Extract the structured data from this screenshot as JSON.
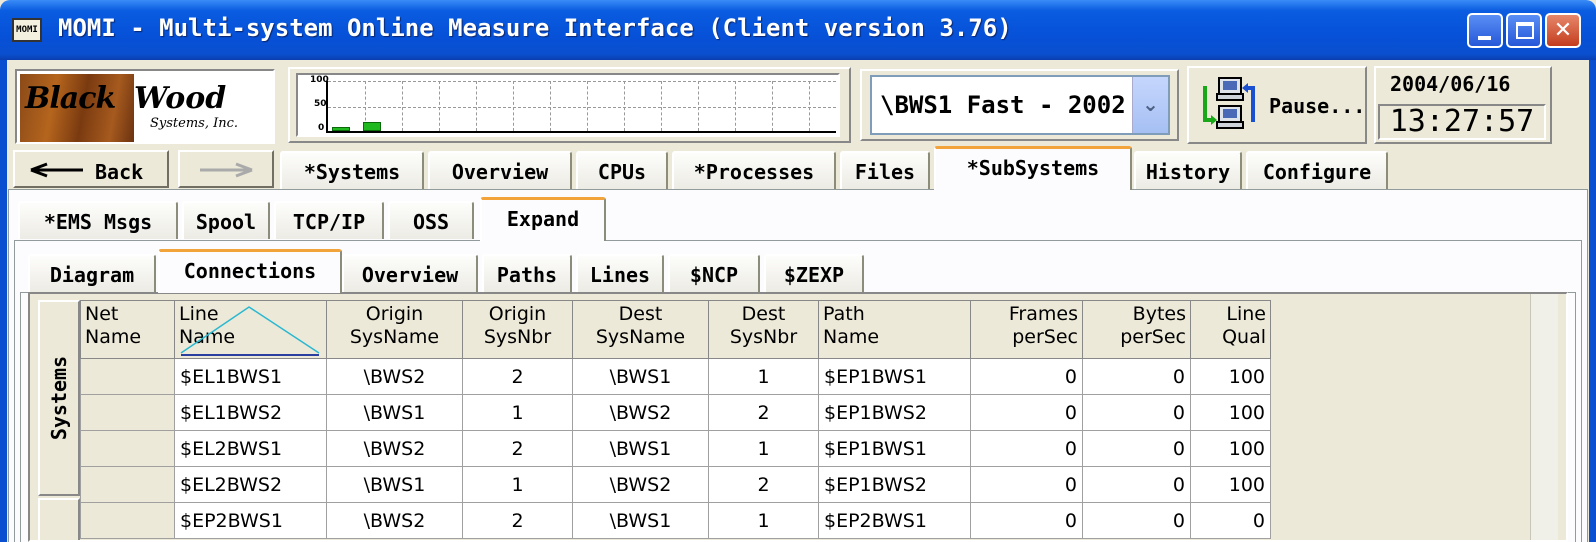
{
  "window": {
    "title": "MOMI - Multi-system Online Measure Interface (Client version 3.76)",
    "icon_text": "MOMI"
  },
  "logo": {
    "word1": "Black",
    "word2": "Wood",
    "sub": "Systems, Inc."
  },
  "graph": {
    "y_labels": [
      "100",
      "50",
      "0"
    ],
    "values": [
      8,
      18
    ]
  },
  "system_select": {
    "value": "\\BWS1 Fast - 2002"
  },
  "pause": {
    "label": "Pause..."
  },
  "datetime": {
    "date": "2004/06/16",
    "time": "13:27:57"
  },
  "nav": {
    "back_label": "Back"
  },
  "main_tabs": [
    "*Systems",
    "Overview",
    "CPUs",
    "*Processes",
    "Files",
    "*SubSystems",
    "History",
    "Configure"
  ],
  "sub_tabs": [
    "*EMS Msgs",
    "Spool",
    "TCP/IP",
    "OSS",
    "Expand"
  ],
  "expand_tabs": [
    "Diagram",
    "Connections",
    "Overview",
    "Paths",
    "Lines",
    "$NCP",
    "$ZEXP"
  ],
  "side_label": "Systems",
  "table": {
    "columns": [
      {
        "l1": "Net",
        "l2": "Name"
      },
      {
        "l1": "Line",
        "l2": "Name"
      },
      {
        "l1": "Origin",
        "l2": "SysName"
      },
      {
        "l1": "Origin",
        "l2": "SysNbr"
      },
      {
        "l1": "Dest",
        "l2": "SysName"
      },
      {
        "l1": "Dest",
        "l2": "SysNbr"
      },
      {
        "l1": "Path",
        "l2": "Name"
      },
      {
        "l1": "Frames",
        "l2": "perSec"
      },
      {
        "l1": "Bytes",
        "l2": "perSec"
      },
      {
        "l1": "Line",
        "l2": "Qual"
      }
    ],
    "rows": [
      [
        "",
        "$EL1BWS1",
        "\\BWS2",
        "2",
        "\\BWS1",
        "1",
        "$EP1BWS1",
        "0",
        "0",
        "100"
      ],
      [
        "",
        "$EL1BWS2",
        "\\BWS1",
        "1",
        "\\BWS2",
        "2",
        "$EP1BWS2",
        "0",
        "0",
        "100"
      ],
      [
        "",
        "$EL2BWS1",
        "\\BWS2",
        "2",
        "\\BWS1",
        "1",
        "$EP1BWS1",
        "0",
        "0",
        "100"
      ],
      [
        "",
        "$EL2BWS2",
        "\\BWS1",
        "1",
        "\\BWS2",
        "2",
        "$EP1BWS2",
        "0",
        "0",
        "100"
      ],
      [
        "",
        "$EP2BWS1",
        "\\BWS2",
        "2",
        "\\BWS1",
        "1",
        "$EP2BWS1",
        "0",
        "0",
        "0"
      ]
    ]
  },
  "colors": {
    "title_blue": "#0651d8",
    "tab_accent": "#f2a33a",
    "bar_green": "#1fb81f"
  }
}
